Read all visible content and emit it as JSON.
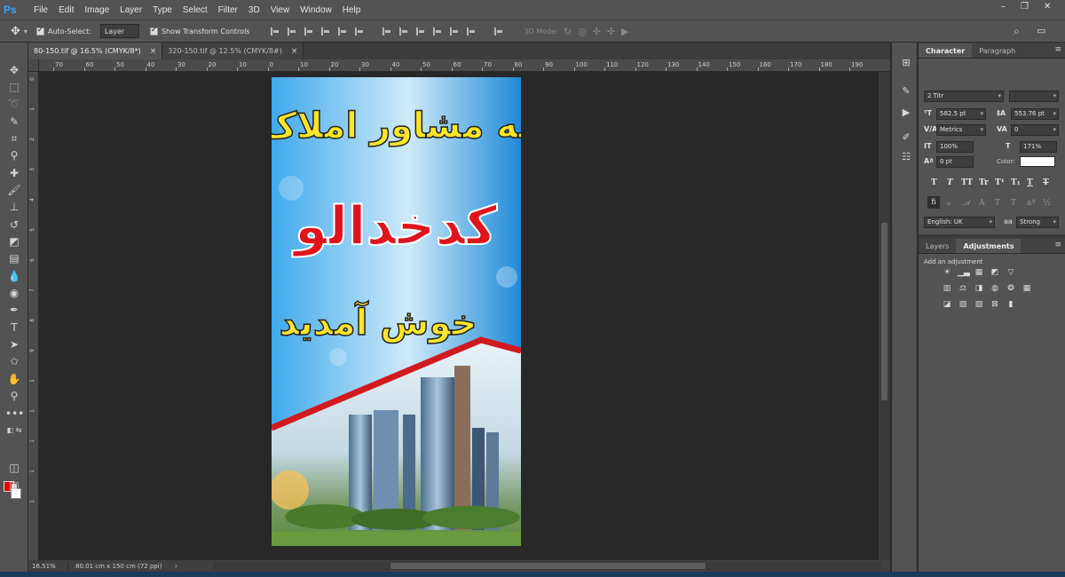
{
  "app": {
    "logo": "Ps"
  },
  "menu": [
    "File",
    "Edit",
    "Image",
    "Layer",
    "Type",
    "Select",
    "Filter",
    "3D",
    "View",
    "Window",
    "Help"
  ],
  "window_controls": [
    "–",
    "❐",
    "✕"
  ],
  "options": {
    "auto_select_label": "Auto-Select:",
    "auto_select_value": "Layer",
    "transform_label": "Show Transform Controls",
    "mode_label": "3D Mode:"
  },
  "tabs": [
    {
      "label": "80-150.tif @ 16.5% (CMYK/8*)",
      "active": true
    },
    {
      "label": "320-150.tif @ 12.5% (CMYK/8#)",
      "active": false
    }
  ],
  "ruler_h": [
    "70",
    "60",
    "50",
    "40",
    "30",
    "20",
    "10",
    "0",
    "10",
    "20",
    "30",
    "40",
    "50",
    "60",
    "70",
    "80",
    "90",
    "100",
    "110",
    "120",
    "130",
    "140",
    "150",
    "160",
    "170",
    "180",
    "190"
  ],
  "ruler_v": [
    "0",
    "1",
    "2",
    "3",
    "4",
    "5",
    "6",
    "7",
    "8",
    "9",
    "1",
    "1",
    "1",
    "1",
    "1"
  ],
  "canvas": {
    "line1": "به مشاور املاک",
    "line2": "کدخدالو",
    "line3": "خوش آمدید"
  },
  "status": {
    "zoom": "16.51%",
    "info": "80.01 cm x 150 cm (72 ppi)",
    "arrow": "›"
  },
  "character": {
    "tab": "Character",
    "tab2": "Paragraph",
    "font": "2 Titr",
    "style": "",
    "size": "582.5 pt",
    "leading": "553.76 pt",
    "kerning": "Metrics",
    "tracking": "0",
    "vscale": "100%",
    "hscale": "171%",
    "baseline": "0 pt",
    "color_label": "Color:",
    "language": "English: UK",
    "antialias": "Strong",
    "fi": "fi"
  },
  "adjustments": {
    "tab_layers": "Layers",
    "tab_adjust": "Adjustments",
    "title": "Add an adjustment"
  },
  "colors": {
    "foreground": "#e00000",
    "background": "#ffffff",
    "accent": "#31a8ff"
  }
}
